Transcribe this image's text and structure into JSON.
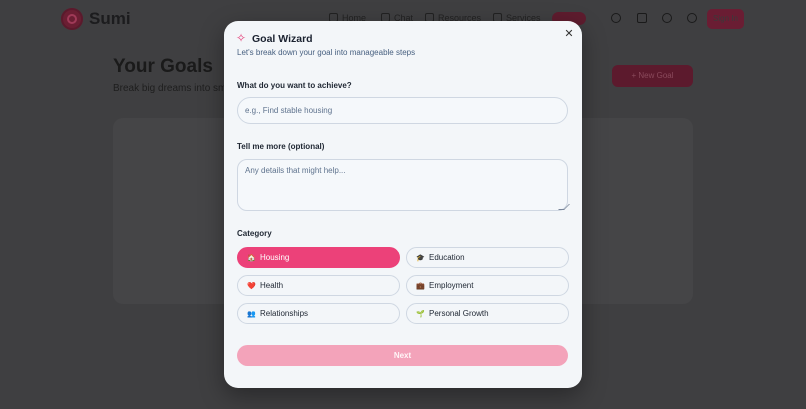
{
  "background": {
    "brand": "Sumi",
    "nav": [
      "Home",
      "Chat",
      "Resources",
      "Services"
    ],
    "sign_in": "Sign In",
    "page_title": "Your Goals",
    "page_subtitle": "Break big dreams into sm",
    "new_goal": "New Goal"
  },
  "modal": {
    "title": "Goal Wizard",
    "title_icon": "sparkles-icon",
    "subtitle": "Let's break down your goal into manageable steps",
    "close_icon": "close-icon",
    "goal_label": "What do you want to achieve?",
    "goal_placeholder": "e.g., Find stable housing",
    "details_label": "Tell me more (optional)",
    "details_placeholder": "Any details that might help...",
    "category_label": "Category",
    "categories": [
      {
        "label": "Housing",
        "emoji": "🏠",
        "selected": true
      },
      {
        "label": "Education",
        "emoji": "🎓",
        "selected": false
      },
      {
        "label": "Health",
        "emoji": "❤️",
        "selected": false
      },
      {
        "label": "Employment",
        "emoji": "💼",
        "selected": false
      },
      {
        "label": "Relationships",
        "emoji": "👥",
        "selected": false
      },
      {
        "label": "Personal Growth",
        "emoji": "🌱",
        "selected": false
      }
    ],
    "next_label": "Next"
  },
  "colors": {
    "accent": "#ec4179",
    "accent_disabled": "#f3a3ba",
    "overlay": "#3f3f41",
    "modal_bg": "#f3f6f9"
  }
}
